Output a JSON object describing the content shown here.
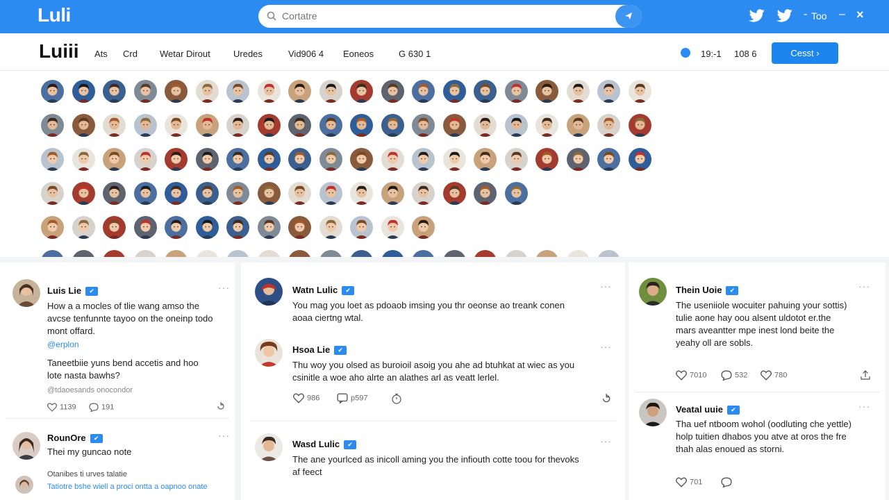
{
  "app": {
    "logo": "Luli"
  },
  "search": {
    "placeholder": "Cortatre"
  },
  "topbar": {
    "user_label": "Too",
    "close_glyph": "×"
  },
  "nav": {
    "brand": "Luiii",
    "items": [
      "Ats",
      "Crd",
      "Wetar Dirout",
      "Uredes",
      "Vid906 4",
      "Eoneos",
      "G 630 1"
    ],
    "stats": [
      "19:-1",
      "108 6"
    ],
    "cta_label": "Cesst ›"
  },
  "colors": {
    "accent": "#2b8bf0",
    "topbar": "#2b8bf0"
  },
  "avatar_rows": [
    20,
    20,
    20,
    16,
    13
  ],
  "posts": [
    {
      "id": "p1",
      "name": "Luis Lie",
      "badge": "✔",
      "body": [
        "How a a mocles of tlie wang amso the",
        "avcse tenfunnte tayoo on the oneinp todo",
        "mont offard."
      ],
      "link": "@erplon",
      "body2": [
        "Taneetbiie yuns bend accetis and hoo",
        "lote nasta bawhs?"
      ],
      "meta": "@tdaoesands onocondor",
      "actions": [
        "1139",
        "191"
      ]
    },
    {
      "id": "p2",
      "name": "RounOre",
      "badge": "✔",
      "body": [
        "Thei my guncao note"
      ],
      "sub": [
        "Otanibes ti urves talatie",
        "Tatiotre bshe wiell a proci ontta a oapnoo onate"
      ]
    },
    {
      "id": "p3",
      "name": "Watn Lulic",
      "badge": "✔",
      "body": [
        "You mag you loet as pdoaob imsing you thr oeonse ao treank conen",
        "aoaa ciertng wtal."
      ]
    },
    {
      "id": "p4",
      "name": "Hsoa Lie",
      "badge": "✔",
      "body": [
        "Thu woy you olsed as buroioil asoig you ahe ad btuhkat at wiec as you",
        "csinitle a woe aho alrte an alathes arl as veatt lerlel."
      ],
      "actions": [
        "986",
        "p597"
      ]
    },
    {
      "id": "p5",
      "name": "Wasd Lulic",
      "badge": "✔",
      "body": [
        "The ane yourlced as inicoll aming you the infiouth cotte toou for thevoks",
        "af feect"
      ]
    },
    {
      "id": "p6",
      "name": "Thein Uoie",
      "badge": "✔",
      "body": [
        "The useniiole wocuiter pahuing your sottis)",
        "tulie aone hay oou alsent uldotot er.the",
        "mars aveantter mpe inest lond beite the",
        "yeahy oll are sobls."
      ],
      "actions": [
        "7010",
        "532",
        "780"
      ]
    },
    {
      "id": "p7",
      "name": "Veatal uuie",
      "badge": "✔",
      "body": [
        "Tha uef ntboom wohol (oodluting che yettle)",
        "holp tuitien dhabos you atve at oros the fre",
        "thah alas enoued as storni."
      ],
      "actions": [
        "701"
      ]
    }
  ]
}
